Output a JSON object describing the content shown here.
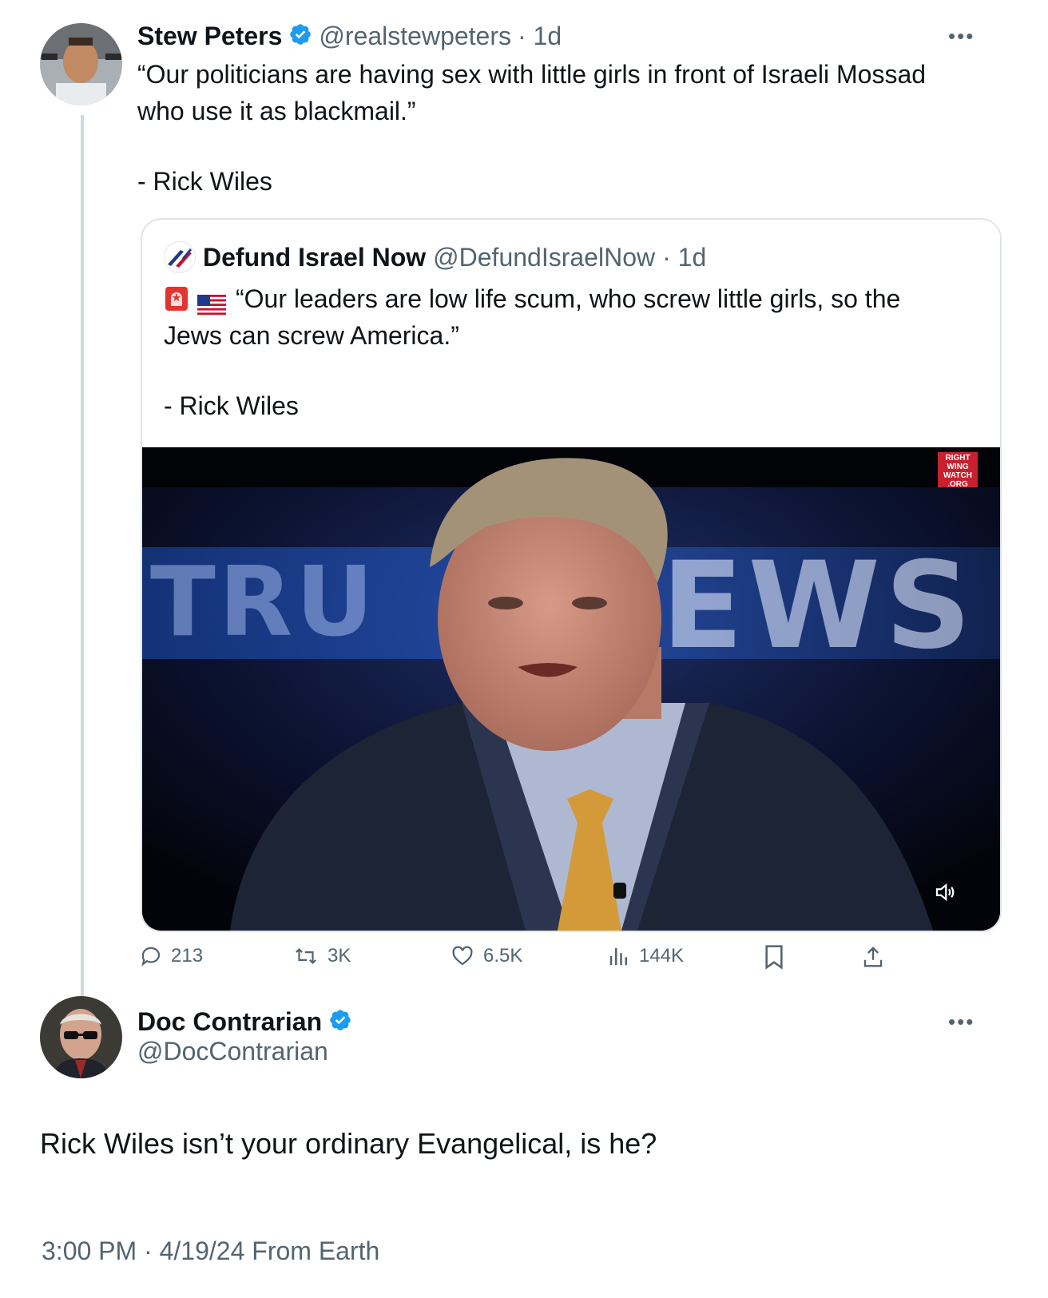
{
  "tweet": {
    "author_name": "Stew Peters",
    "author_handle": "@realstewpeters",
    "time": "· 1d",
    "text_line1": "“Our politicians are having sex with little girls in front of Israeli Mossad",
    "text_line2": "who use it as blackmail.”",
    "attribution": "- Rick Wiles",
    "more": "•••"
  },
  "quote": {
    "author_name": "Defund Israel Now",
    "author_handle": "@DefundIsraelNow",
    "time": "· 1d",
    "text_line1": "“Our leaders are low life scum, who screw little girls, so the",
    "text_line2": "Jews can screw America.”",
    "attribution": "- Rick Wiles",
    "video": {
      "bg_text_left": "TRU",
      "bg_text_right": "EWS",
      "watermark": "RIGHT WING WATCH .ORG"
    }
  },
  "actions": {
    "replies": "213",
    "reposts": "3K",
    "likes": "6.5K",
    "views": "144K"
  },
  "reply": {
    "author_name": "Doc Contrarian",
    "author_handle": "@DocContrarian",
    "text": "Rick Wiles isn’t your ordinary Evangelical, is he?",
    "footer": "3:00 PM · 4/19/24 From Earth",
    "more": "•••"
  },
  "colors": {
    "verified": "#1d9bf0",
    "muted": "#536471",
    "border": "#dfe5e8"
  }
}
